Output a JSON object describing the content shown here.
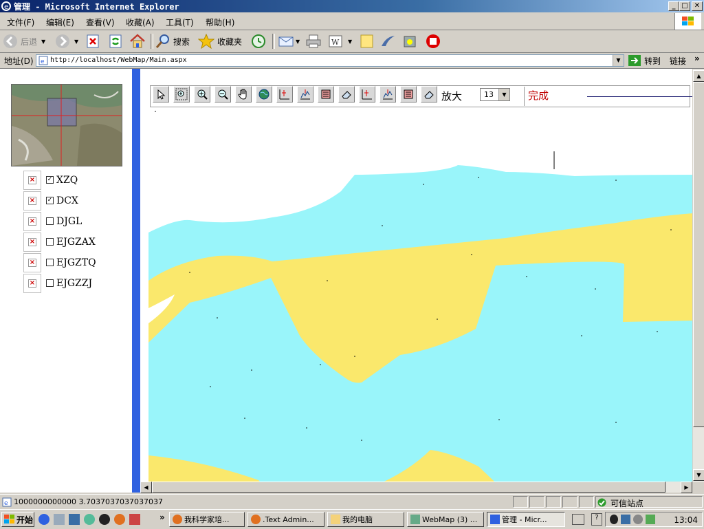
{
  "window": {
    "title": "管理 - Microsoft Internet Explorer",
    "min": "_",
    "max": "□",
    "close": "✕"
  },
  "menu": [
    "文件(F)",
    "编辑(E)",
    "查看(V)",
    "收藏(A)",
    "工具(T)",
    "帮助(H)"
  ],
  "toolbar": {
    "back": "后退",
    "search": "搜索",
    "favorites": "收藏夹"
  },
  "address": {
    "label": "地址(D)",
    "url": "http://localhost/WebMap/Main.aspx",
    "go": "转到",
    "links": "链接"
  },
  "layers": [
    {
      "name": "XZQ",
      "checked": true
    },
    {
      "name": "DCX",
      "checked": true
    },
    {
      "name": "DJGL",
      "checked": false
    },
    {
      "name": "EJGZAX",
      "checked": false
    },
    {
      "name": "EJGZTQ",
      "checked": false
    },
    {
      "name": "EJGZZJ",
      "checked": false
    }
  ],
  "map": {
    "zoom_label": "放大",
    "zoom_level": "13",
    "status": "完成",
    "colors": {
      "water": "#99f5fa",
      "land": "#fae86c",
      "background": "#ffffff"
    }
  },
  "statusbar": {
    "text": "1000000000000 3.7037037037037037",
    "zone": "可信站点"
  },
  "taskbar": {
    "start": "开始",
    "tasks": [
      "我科学家培...",
      ".Text Admin...",
      "我的电脑",
      "WebMap (3) ...",
      "管理 - Micr..."
    ],
    "clock": "13:04"
  }
}
